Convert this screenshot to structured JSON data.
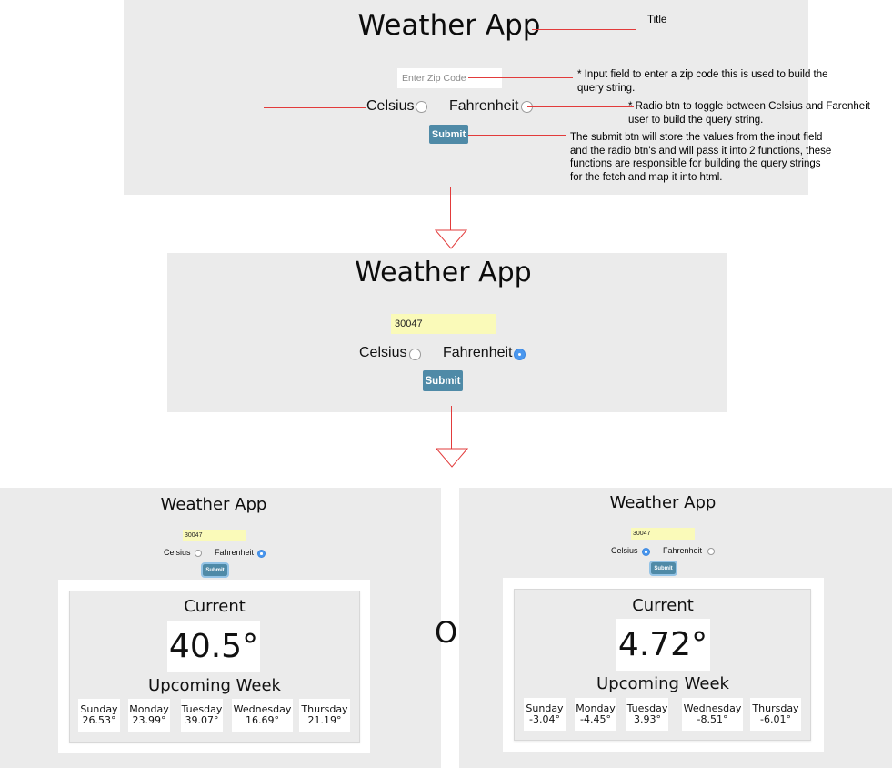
{
  "app_title": "Weather App",
  "annotations": {
    "title": "Title",
    "input": "* Input field to enter a zip code this is used to build the query string.",
    "radio": "* Radio btn to toggle between Celsius and Farenheit user to build the query string.",
    "submit": "The submit btn will store the values from the input field and the radio btn's and will pass it into 2 functions, these functions are responsible for building the query strings for the fetch and map it into html."
  },
  "form": {
    "zip_placeholder": "Enter Zip Code",
    "zip_value": "30047",
    "celsius_label": "Celsius",
    "fahrenheit_label": "Fahrenheit",
    "submit_label": "Submit"
  },
  "separator": "OR",
  "results": [
    {
      "unit_selected": "Fahrenheit",
      "current_label": "Current",
      "current_temp": "40.5°",
      "upcoming_label": "Upcoming Week",
      "days": [
        {
          "day": "Sunday",
          "temp": "26.53°"
        },
        {
          "day": "Monday",
          "temp": "23.99°"
        },
        {
          "day": "Tuesday",
          "temp": "39.07°"
        },
        {
          "day": "Wednesday",
          "temp": "16.69°"
        },
        {
          "day": "Thursday",
          "temp": "21.19°"
        }
      ]
    },
    {
      "unit_selected": "Celsius",
      "current_label": "Current",
      "current_temp": "4.72°",
      "upcoming_label": "Upcoming Week",
      "days": [
        {
          "day": "Sunday",
          "temp": "-3.04°"
        },
        {
          "day": "Monday",
          "temp": "-4.45°"
        },
        {
          "day": "Tuesday",
          "temp": "3.93°"
        },
        {
          "day": "Wednesday",
          "temp": "-8.51°"
        },
        {
          "day": "Thursday",
          "temp": "-6.01°"
        }
      ]
    }
  ],
  "colors": {
    "panel_bg": "#ebebeb",
    "submit_button": "#4f8aa7",
    "radio_selected": "#4a97ee",
    "input_filled": "#fafab9",
    "annotation_line": "#e23b3b"
  }
}
